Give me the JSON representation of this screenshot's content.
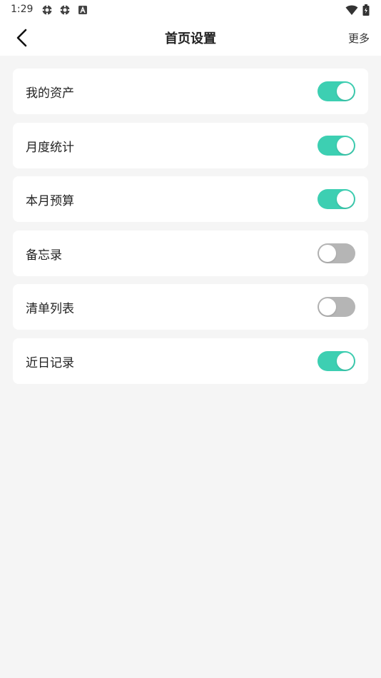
{
  "status_bar": {
    "time": "1:29",
    "icons_left": [
      "settings-gear-icon",
      "settings-gear-icon",
      "font-a-icon"
    ],
    "icons_right": [
      "wifi-icon",
      "battery-icon"
    ]
  },
  "header": {
    "title": "首页设置",
    "more_label": "更多",
    "back_icon": "chevron-left-icon"
  },
  "settings": [
    {
      "label": "我的资产",
      "enabled": true
    },
    {
      "label": "月度统计",
      "enabled": true
    },
    {
      "label": "本月预算",
      "enabled": true
    },
    {
      "label": "备忘录",
      "enabled": false
    },
    {
      "label": "清单列表",
      "enabled": false
    },
    {
      "label": "近日记录",
      "enabled": true
    }
  ],
  "colors": {
    "toggle_on": "#3dcfb2",
    "toggle_off": "#b5b5b5",
    "background": "#f5f5f5"
  }
}
